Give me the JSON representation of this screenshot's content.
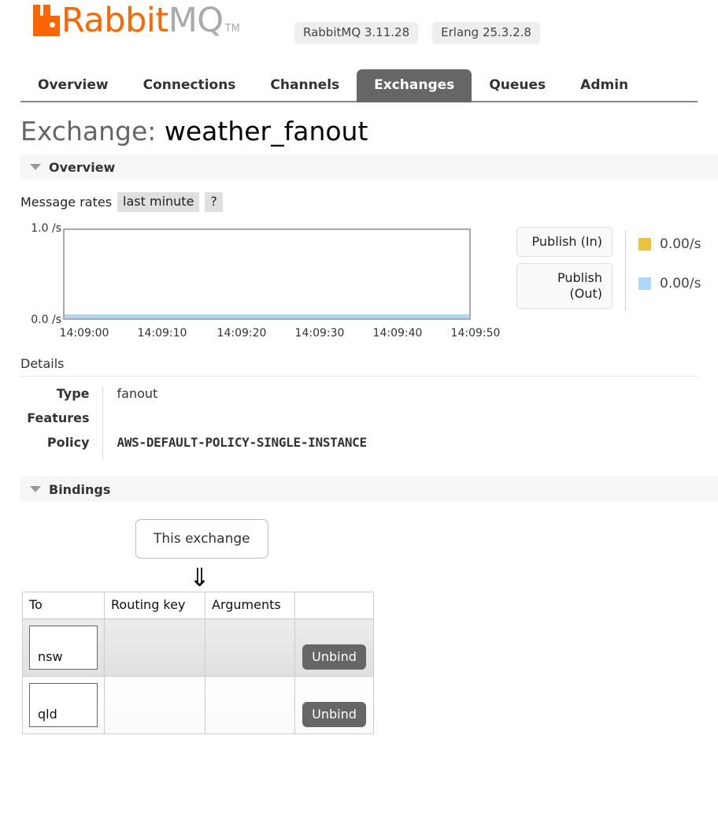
{
  "header": {
    "logo_rabbit": "Rabbit",
    "logo_mq": "MQ",
    "logo_tm": "TM",
    "versions": [
      {
        "label": "RabbitMQ 3.11.28"
      },
      {
        "label": "Erlang 25.3.2.8"
      }
    ]
  },
  "nav": {
    "tabs": [
      {
        "label": "Overview",
        "active": false
      },
      {
        "label": "Connections",
        "active": false
      },
      {
        "label": "Channels",
        "active": false
      },
      {
        "label": "Exchanges",
        "active": true
      },
      {
        "label": "Queues",
        "active": false
      },
      {
        "label": "Admin",
        "active": false
      }
    ]
  },
  "page": {
    "title_label": "Exchange:",
    "title_value": "weather_fanout"
  },
  "overview": {
    "section_title": "Overview",
    "rates_label": "Message rates",
    "rates_period": "last minute",
    "help": "?"
  },
  "chart_data": {
    "type": "line",
    "title": "Message rates",
    "xlabel": "",
    "ylabel": "/s",
    "ylim": [
      0.0,
      1.0
    ],
    "ytick_labels": [
      "1.0 /s",
      "0.0 /s"
    ],
    "x": [
      "14:09:00",
      "14:09:10",
      "14:09:20",
      "14:09:30",
      "14:09:40",
      "14:09:50"
    ],
    "grid": false,
    "legend_position": "right",
    "series": [
      {
        "name": "Publish (In)",
        "color": "#edc240",
        "rate": "0.00/s",
        "values": [
          0,
          0,
          0,
          0,
          0,
          0
        ]
      },
      {
        "name": "Publish (Out)",
        "color": "#afd8f8",
        "rate": "0.00/s",
        "values": [
          0,
          0,
          0,
          0,
          0,
          0
        ]
      }
    ]
  },
  "details": {
    "label": "Details",
    "rows": [
      {
        "key": "Type",
        "value": "fanout",
        "style": "plain"
      },
      {
        "key": "Features",
        "value": "",
        "style": "plain"
      },
      {
        "key": "Policy",
        "value": "AWS-DEFAULT-POLICY-SINGLE-INSTANCE",
        "style": "policy"
      }
    ]
  },
  "bindings": {
    "section_title": "Bindings",
    "this_exchange": "This exchange",
    "arrow": "⇓",
    "columns": [
      "To",
      "Routing key",
      "Arguments",
      ""
    ],
    "rows": [
      {
        "to": "nsw",
        "routing_key": "",
        "arguments": "",
        "action": "Unbind"
      },
      {
        "to": "qld",
        "routing_key": "",
        "arguments": "",
        "action": "Unbind"
      }
    ]
  }
}
